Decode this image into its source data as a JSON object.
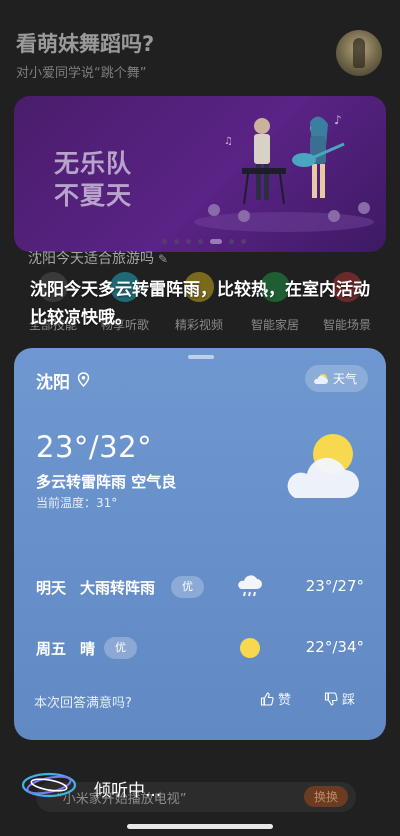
{
  "background": {
    "title": "看萌妹舞蹈吗?",
    "subtitle": "对小爱同学说“跳个舞”",
    "banner": {
      "line1": "无乐队",
      "line2": "不夏天"
    },
    "bubble": "沈阳今天适合旅游吗",
    "quick_items": [
      {
        "label": "全部技能",
        "color": "#3a3a3a"
      },
      {
        "label": "畅享听歌",
        "color": "#1f6a74"
      },
      {
        "label": "精彩视频",
        "color": "#7a6a1d"
      },
      {
        "label": "智能家居",
        "color": "#1f5e33"
      },
      {
        "label": "智能场景",
        "color": "#6a2a2a"
      }
    ],
    "bottom_bubble": "“小米家开始播放电视”",
    "bottom_pill": "换换"
  },
  "response_text": "沈阳今天多云转雷阵雨，比较热，在室内活动比较凉快哦。",
  "weather": {
    "city": "沈阳",
    "tag_label": "天气",
    "temp_range": "23°/32°",
    "condition": "多云转雷阵雨 空气良",
    "current_temp": "当前温度：31°",
    "forecast": [
      {
        "day": "明天",
        "desc": "大雨转阵雨",
        "aqi": "优",
        "range": "23°/27°",
        "icon": "rain-cloud-icon"
      },
      {
        "day": "周五",
        "desc": "晴",
        "aqi": "优",
        "range": "22°/34°",
        "icon": "sun-icon"
      }
    ],
    "feedback_question": "本次回答满意吗?",
    "like_label": "赞",
    "dislike_label": "踩"
  },
  "listening_text": "倾听中...",
  "colors": {
    "card_bg": "#6890ca",
    "banner_bg": "#5a2386",
    "sun": "#f6d94e"
  }
}
